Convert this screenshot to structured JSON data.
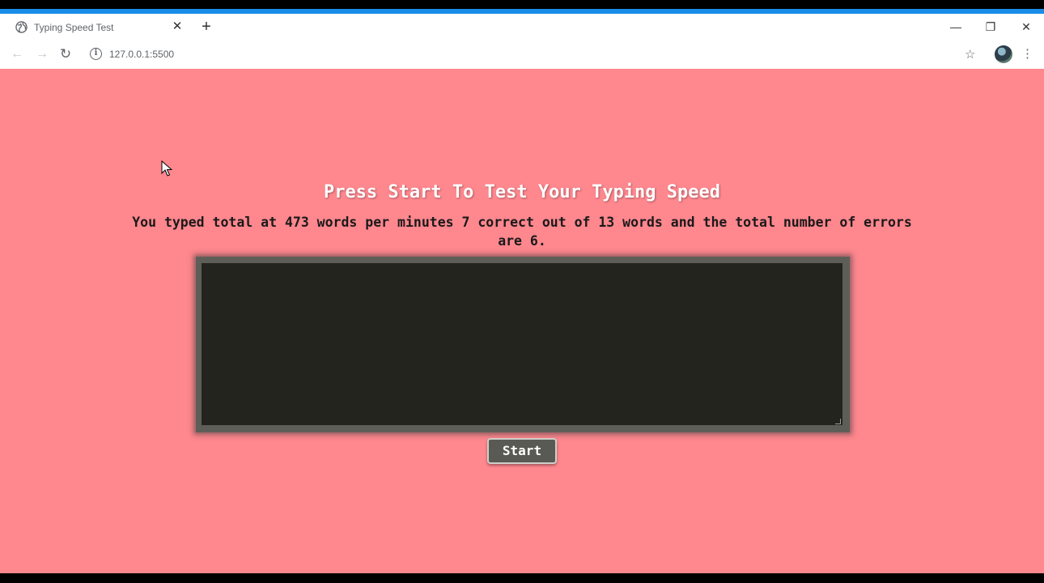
{
  "browser": {
    "tab_title": "Typing Speed Test",
    "tab_close_glyph": "✕",
    "new_tab_glyph": "+",
    "url": "127.0.0.1:5500",
    "window_controls": {
      "minimize": "—",
      "restore": "❐",
      "close": "✕"
    }
  },
  "page": {
    "heading": "Press Start To Test Your Typing Speed",
    "result_text": "You typed total at 473 words per minutes 7 correct out of 13 words and the total number of errors are 6.",
    "textarea_value": "",
    "start_label": "Start",
    "background_color": "#ff878e"
  },
  "icons": {
    "favicon": "globe-icon",
    "back": "arrow-left-icon",
    "forward": "arrow-right-icon",
    "reload": "reload-icon",
    "info": "info-icon",
    "star": "star-icon",
    "menu": "kebab-menu-icon"
  }
}
